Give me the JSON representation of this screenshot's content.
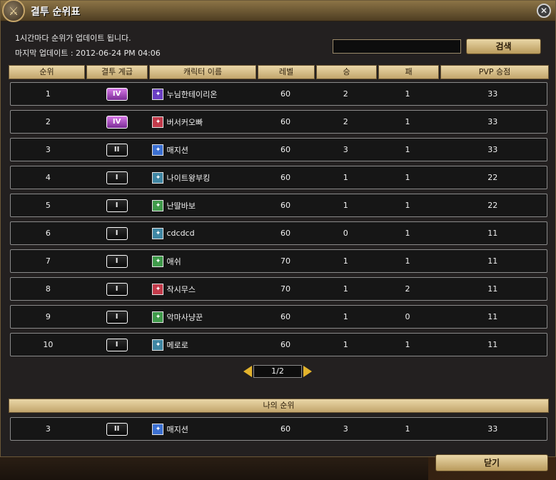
{
  "window": {
    "title": "결투 순위표",
    "close_glyph": "✕"
  },
  "info": {
    "update_notice": "1시간마다 순위가 업데이트 됩니다.",
    "last_update": "마지막 업데이트 : 2012-06-24 PM 04:06"
  },
  "search": {
    "value": "",
    "button_label": "검색"
  },
  "table": {
    "headers": [
      "순위",
      "결투 계급",
      "캐릭터 이름",
      "레벨",
      "승",
      "패",
      "PVP 승점"
    ],
    "rows": [
      {
        "rank": "1",
        "grade": "IV",
        "grade_style": "iv",
        "class": "purple",
        "name": "누님한테이리온",
        "level": "60",
        "win": "2",
        "lose": "1",
        "pvp": "33"
      },
      {
        "rank": "2",
        "grade": "IV",
        "grade_style": "iv",
        "class": "red",
        "name": "버서커오빠",
        "level": "60",
        "win": "2",
        "lose": "1",
        "pvp": "33"
      },
      {
        "rank": "3",
        "grade": "II",
        "grade_style": "ii",
        "class": "blue",
        "name": "매지션",
        "level": "60",
        "win": "3",
        "lose": "1",
        "pvp": "33"
      },
      {
        "rank": "4",
        "grade": "I",
        "grade_style": "i",
        "class": "cyan",
        "name": "나이트왕부킹",
        "level": "60",
        "win": "1",
        "lose": "1",
        "pvp": "22"
      },
      {
        "rank": "5",
        "grade": "I",
        "grade_style": "i",
        "class": "green",
        "name": "난딸바보",
        "level": "60",
        "win": "1",
        "lose": "1",
        "pvp": "22"
      },
      {
        "rank": "6",
        "grade": "I",
        "grade_style": "i",
        "class": "cyan",
        "name": "cdcdcd",
        "level": "60",
        "win": "0",
        "lose": "1",
        "pvp": "11"
      },
      {
        "rank": "7",
        "grade": "I",
        "grade_style": "i",
        "class": "green",
        "name": "애쉬",
        "level": "70",
        "win": "1",
        "lose": "1",
        "pvp": "11"
      },
      {
        "rank": "8",
        "grade": "I",
        "grade_style": "i",
        "class": "red",
        "name": "작시무스",
        "level": "70",
        "win": "1",
        "lose": "2",
        "pvp": "11"
      },
      {
        "rank": "9",
        "grade": "I",
        "grade_style": "i",
        "class": "green",
        "name": "악마사냥꾼",
        "level": "60",
        "win": "1",
        "lose": "0",
        "pvp": "11"
      },
      {
        "rank": "10",
        "grade": "I",
        "grade_style": "i",
        "class": "cyan",
        "name": "메로로",
        "level": "60",
        "win": "1",
        "lose": "1",
        "pvp": "11"
      }
    ]
  },
  "pager": {
    "page_text": "1/2"
  },
  "my_rank": {
    "header": "나의 순위",
    "row": {
      "rank": "3",
      "grade": "II",
      "grade_style": "ii",
      "class": "blue",
      "name": "매지션",
      "level": "60",
      "win": "3",
      "lose": "1",
      "pvp": "33"
    }
  },
  "footer": {
    "close_label": "닫기"
  },
  "colors": {
    "accent_gold": "#c2a56c",
    "arrow_yellow": "#e3b32c",
    "grade_iv_purple": "#b050d0"
  }
}
